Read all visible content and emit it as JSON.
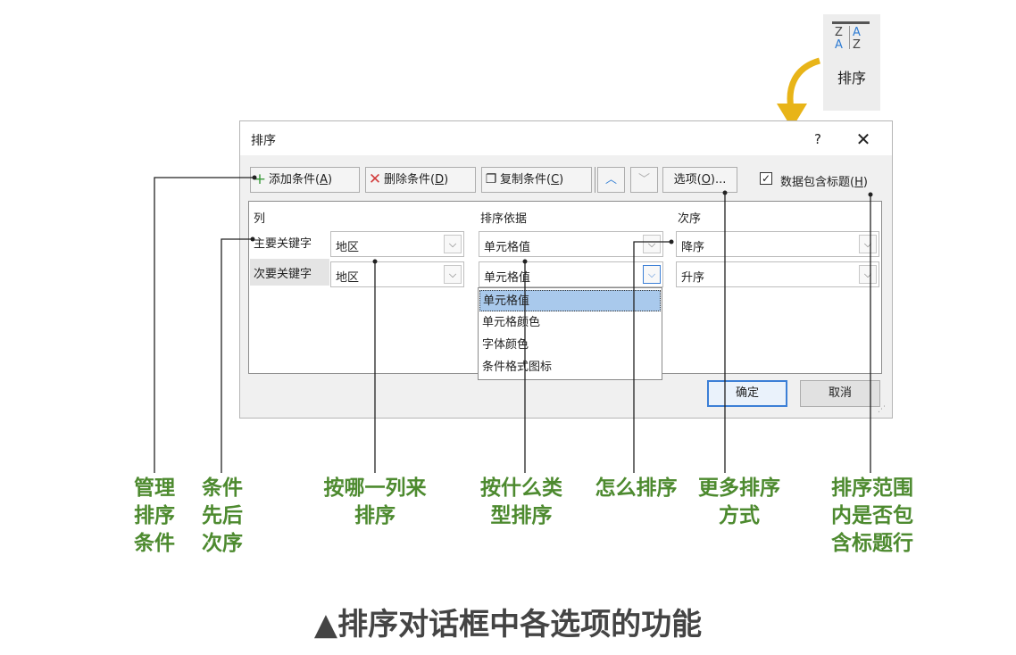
{
  "ribbon": {
    "sort_glyph_top": "ZA",
    "sort_glyph_bottom": "AZ",
    "sort_label": "排序"
  },
  "dialog": {
    "title": "排序",
    "help_label": "?",
    "close_label": "✕",
    "toolbar": {
      "add_label": "添加条件(",
      "add_key": "A",
      "delete_label": "删除条件(",
      "delete_key": "D",
      "copy_label": "复制条件(",
      "copy_key": "C",
      "up_label": "︿",
      "down_label": "﹀",
      "options_label": "选项(",
      "options_key": "O",
      "options_tail": ")...",
      "close_paren": ")",
      "has_header_label": "数据包含标题(",
      "has_header_key": "H",
      "has_header_checked": true
    },
    "columns": {
      "col": "列",
      "sort_on": "排序依据",
      "order": "次序"
    },
    "rows": [
      {
        "label": "主要关键字",
        "column": "地区",
        "sort_on": "单元格值",
        "order": "降序"
      },
      {
        "label": "次要关键字",
        "column": "地区",
        "sort_on": "单元格值",
        "order": "升序"
      }
    ],
    "sort_on_options": [
      "单元格值",
      "单元格颜色",
      "字体颜色",
      "条件格式图标"
    ],
    "ok_label": "确定",
    "cancel_label": "取消"
  },
  "annotations": {
    "manage": "管理\n排序\n条件",
    "priority": "条件\n先后\n次序",
    "which_column": "按哪一列来\n排序",
    "by_type": "按什么类\n型排序",
    "how": "怎么排序",
    "more": "更多排序\n方式",
    "header": "排序范围\n内是否包\n含标题行"
  },
  "caption": "▲排序对话框中各选项的功能",
  "colors": {
    "annotation": "#4d8a2f",
    "arrow": "#e8b418",
    "accent": "#3c7fd6"
  }
}
